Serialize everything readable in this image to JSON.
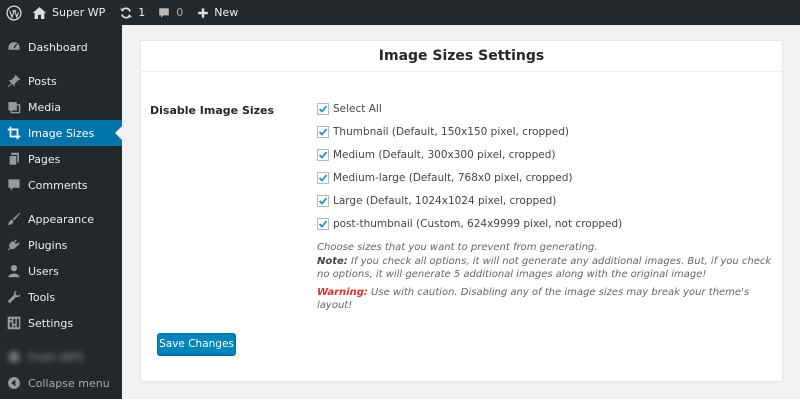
{
  "admin_bar": {
    "site_name": "Super WP",
    "updates_count": "1",
    "comments_count": "0",
    "new_label": "New"
  },
  "sidebar": {
    "items": [
      {
        "label": "Dashboard",
        "icon": "dashboard-icon"
      },
      {
        "label": "Posts",
        "icon": "pin-icon"
      },
      {
        "label": "Media",
        "icon": "media-icon"
      },
      {
        "label": "Image Sizes",
        "icon": "crop-icon",
        "current": true
      },
      {
        "label": "Pages",
        "icon": "pages-icon"
      },
      {
        "label": "Comments",
        "icon": "comment-icon"
      },
      {
        "label": "Appearance",
        "icon": "brush-icon"
      },
      {
        "label": "Plugins",
        "icon": "plugin-icon"
      },
      {
        "label": "Users",
        "icon": "user-icon"
      },
      {
        "label": "Tools",
        "icon": "wrench-icon"
      },
      {
        "label": "Settings",
        "icon": "settings-icon"
      }
    ],
    "blurred_item": "Froth WPS",
    "collapse_label": "Collapse menu"
  },
  "page": {
    "title": "Image Sizes Settings",
    "row_label": "Disable Image Sizes",
    "options": [
      {
        "label": "Select All",
        "checked": true
      },
      {
        "label": "Thumbnail (Default, 150x150 pixel, cropped)",
        "checked": true
      },
      {
        "label": "Medium (Default, 300x300 pixel, cropped)",
        "checked": true
      },
      {
        "label": "Medium-large (Default, 768x0 pixel, cropped)",
        "checked": true
      },
      {
        "label": "Large (Default, 1024x1024 pixel, cropped)",
        "checked": true
      },
      {
        "label": "post-thumbnail (Custom, 624x9999 pixel, not cropped)",
        "checked": true
      }
    ],
    "description": "Choose sizes that you want to prevent from generating.",
    "note_label": "Note:",
    "note_text": " If you check all options, it will not generate any additional images. But, if you check no options, it will generate 5 additional images along with the original image!",
    "warning_label": "Warning:",
    "warning_text": " Use with caution. Disabling any of the image sizes may break your theme's layout!",
    "save_label": "Save Changes"
  },
  "colors": {
    "admin_bg": "#23282d",
    "accent": "#0073aa",
    "button": "#0085ba",
    "warning": "#dc3232"
  }
}
